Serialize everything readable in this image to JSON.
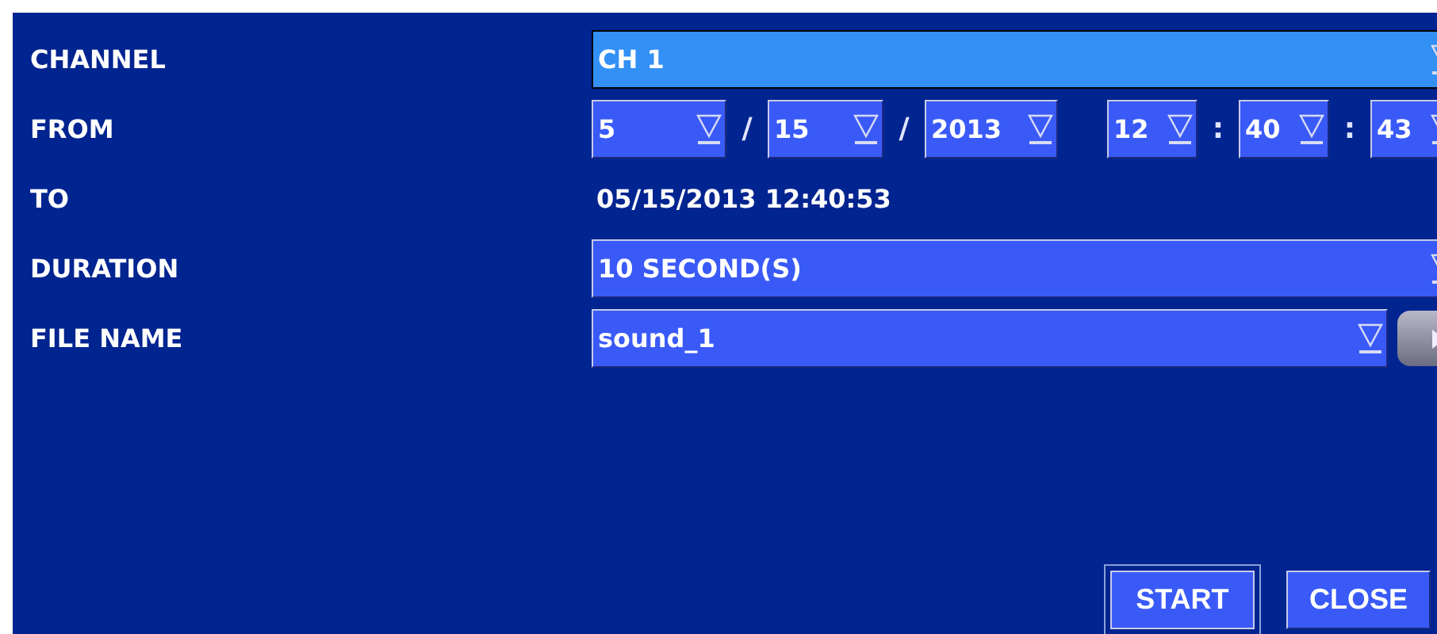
{
  "rows": [
    {
      "kind": "select",
      "label": "CHANNEL",
      "value": "CH 1",
      "focused": true
    },
    {
      "kind": "datetime",
      "label": "FROM",
      "parts": [
        {
          "value": "5",
          "sep": "/"
        },
        {
          "value": "15",
          "sep": "/"
        },
        {
          "value": "2013"
        },
        {
          "value": "12",
          "sep": ":"
        },
        {
          "value": "40",
          "sep": ":"
        },
        {
          "value": "43"
        }
      ]
    },
    {
      "kind": "text",
      "label": "TO",
      "value": "05/15/2013 12:40:53"
    },
    {
      "kind": "select",
      "label": "DURATION",
      "value": "10 SECOND(S)",
      "focused": false
    },
    {
      "kind": "file",
      "label": "FILE NAME",
      "value": "sound_1",
      "focused": false
    }
  ],
  "buttons": [
    {
      "label": "START",
      "focused": true
    },
    {
      "label": "CLOSE",
      "focused": false
    }
  ]
}
